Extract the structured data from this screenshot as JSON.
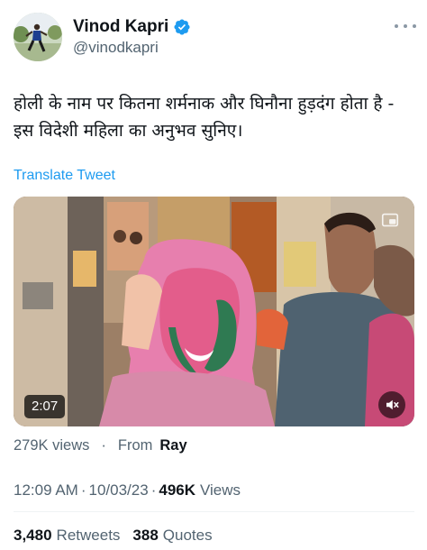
{
  "author": {
    "display_name": "Vinod Kapri",
    "handle": "@vinodkapri",
    "verified": true,
    "avatar_icon": "profile-avatar"
  },
  "more_icon": "more-options-icon",
  "tweet": {
    "text_line1": "होली के नाम पर कितना शर्मनाक और घिनौना हुड़दंग होता है -",
    "text_line2": "इस विदेशी महिला का अनुभव सुनिए।",
    "translate_label": "Translate Tweet"
  },
  "media": {
    "type": "video",
    "duration": "2:07",
    "mute_icon": "muted-speaker-icon",
    "pip_icon": "picture-in-picture-icon"
  },
  "video_stats": {
    "views": "279K views",
    "separator": "·",
    "from_label": "From",
    "source": "Ray"
  },
  "meta": {
    "time": "12:09 AM",
    "separator": "·",
    "date": "10/03/23",
    "separator2": "·",
    "views_count": "496K",
    "views_label": "Views"
  },
  "stats": {
    "retweets_count": "3,480",
    "retweets_label": "Retweets",
    "quotes_count": "388",
    "quotes_label": "Quotes"
  },
  "colors": {
    "accent": "#1d9bf0",
    "text_primary": "#0f1419",
    "text_secondary": "#536471",
    "divider": "#eff3f4"
  }
}
